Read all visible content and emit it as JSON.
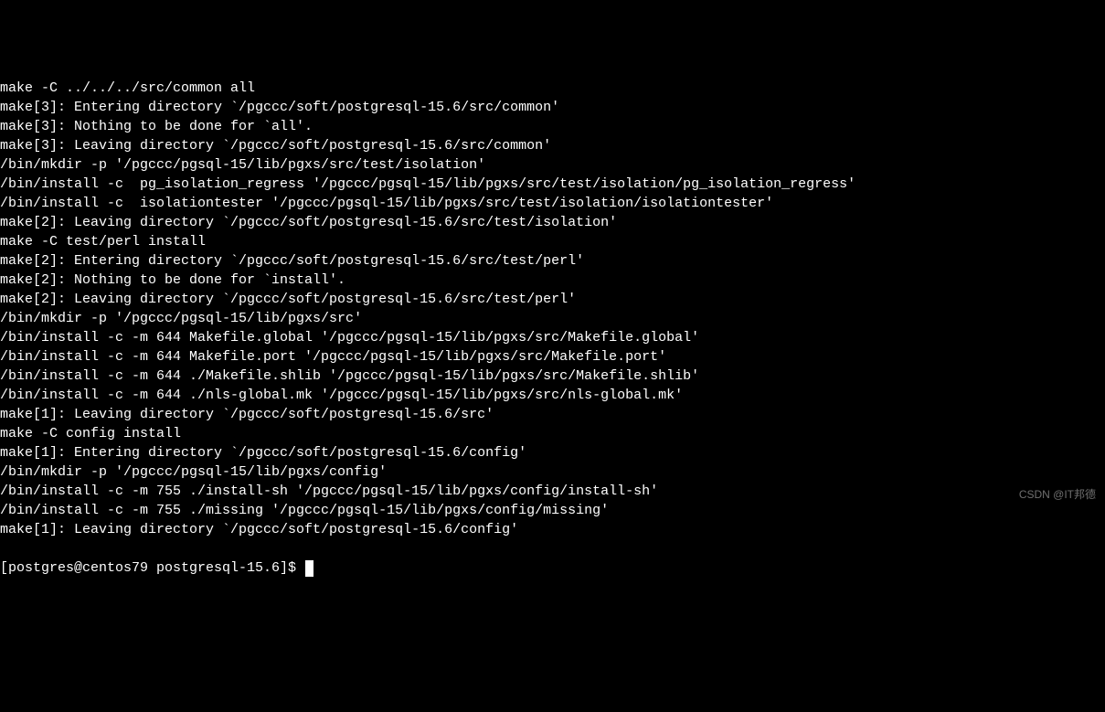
{
  "terminal": {
    "lines": [
      "make -C ../../../src/common all",
      "make[3]: Entering directory `/pgccc/soft/postgresql-15.6/src/common'",
      "make[3]: Nothing to be done for `all'.",
      "make[3]: Leaving directory `/pgccc/soft/postgresql-15.6/src/common'",
      "/bin/mkdir -p '/pgccc/pgsql-15/lib/pgxs/src/test/isolation'",
      "/bin/install -c  pg_isolation_regress '/pgccc/pgsql-15/lib/pgxs/src/test/isolation/pg_isolation_regress'",
      "/bin/install -c  isolationtester '/pgccc/pgsql-15/lib/pgxs/src/test/isolation/isolationtester'",
      "make[2]: Leaving directory `/pgccc/soft/postgresql-15.6/src/test/isolation'",
      "make -C test/perl install",
      "make[2]: Entering directory `/pgccc/soft/postgresql-15.6/src/test/perl'",
      "make[2]: Nothing to be done for `install'.",
      "make[2]: Leaving directory `/pgccc/soft/postgresql-15.6/src/test/perl'",
      "/bin/mkdir -p '/pgccc/pgsql-15/lib/pgxs/src'",
      "/bin/install -c -m 644 Makefile.global '/pgccc/pgsql-15/lib/pgxs/src/Makefile.global'",
      "/bin/install -c -m 644 Makefile.port '/pgccc/pgsql-15/lib/pgxs/src/Makefile.port'",
      "/bin/install -c -m 644 ./Makefile.shlib '/pgccc/pgsql-15/lib/pgxs/src/Makefile.shlib'",
      "/bin/install -c -m 644 ./nls-global.mk '/pgccc/pgsql-15/lib/pgxs/src/nls-global.mk'",
      "make[1]: Leaving directory `/pgccc/soft/postgresql-15.6/src'",
      "make -C config install",
      "make[1]: Entering directory `/pgccc/soft/postgresql-15.6/config'",
      "/bin/mkdir -p '/pgccc/pgsql-15/lib/pgxs/config'",
      "/bin/install -c -m 755 ./install-sh '/pgccc/pgsql-15/lib/pgxs/config/install-sh'",
      "/bin/install -c -m 755 ./missing '/pgccc/pgsql-15/lib/pgxs/config/missing'",
      "make[1]: Leaving directory `/pgccc/soft/postgresql-15.6/config'"
    ],
    "prompt": "[postgres@centos79 postgresql-15.6]$ "
  },
  "watermark": "CSDN @IT邦德"
}
